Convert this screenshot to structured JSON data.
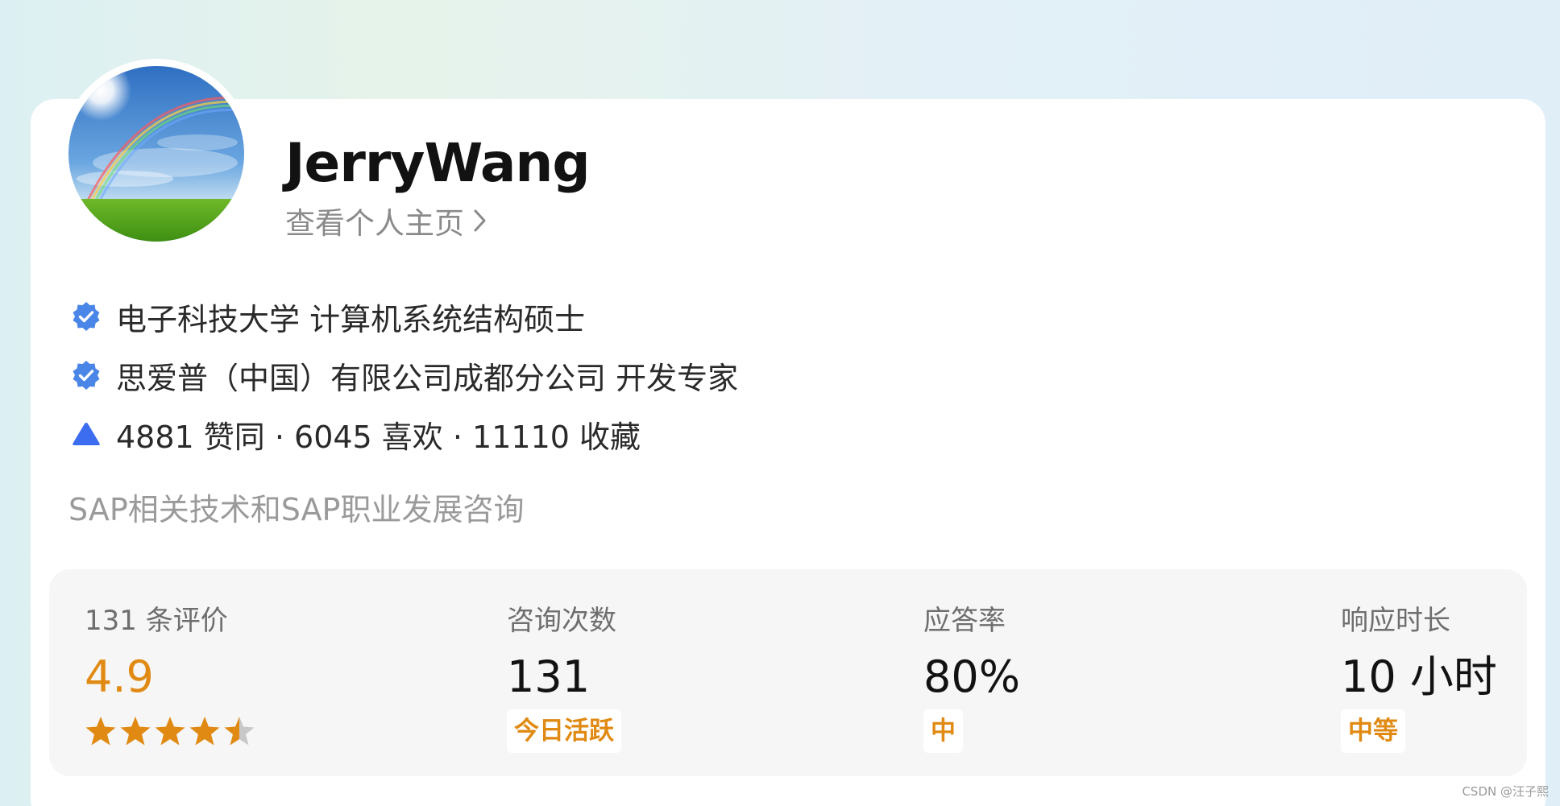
{
  "profile": {
    "name": "JerryWang",
    "view_profile_label": "查看个人主页",
    "verifications": [
      {
        "text": "电子科技大学 计算机系统结构硕士",
        "icon": "verified-badge-icon"
      },
      {
        "text": "思爱普（中国）有限公司成都分公司 开发专家",
        "icon": "verified-badge-icon"
      }
    ],
    "stats_line": {
      "icon": "upvote-triangle-icon",
      "text": "4881 赞同 · 6045 喜欢 · 11110 收藏"
    },
    "bio": "SAP相关技术和SAP职业发展咨询"
  },
  "stats": {
    "rating": {
      "label": "131 条评价",
      "value": "4.9",
      "stars": 4.9
    },
    "consultations": {
      "label": "咨询次数",
      "value": "131",
      "tag": "今日活跃"
    },
    "answer_rate": {
      "label": "应答率",
      "value": "80%",
      "tag": "中"
    },
    "response_time": {
      "label": "响应时长",
      "value": "10 小时",
      "tag": "中等"
    }
  },
  "watermark": "CSDN @汪子熙",
  "colors": {
    "accent_orange": "#e08a13",
    "verified_blue": "#4a86e8",
    "upvote_blue": "#3c6cf0",
    "star_gray": "#c8c8c8"
  }
}
